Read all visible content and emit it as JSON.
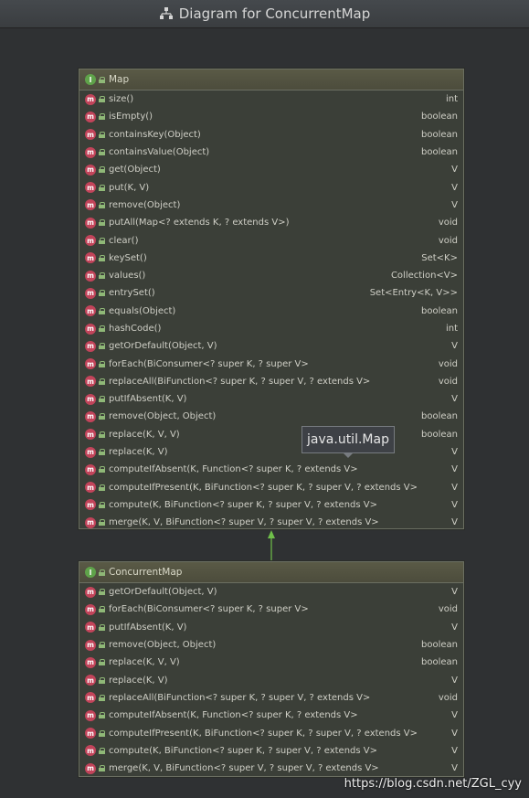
{
  "window": {
    "title": "Diagram for ConcurrentMap"
  },
  "map_panel": {
    "name": "Map",
    "methods": [
      {
        "name": "size()",
        "type": "int"
      },
      {
        "name": "isEmpty()",
        "type": "boolean"
      },
      {
        "name": "containsKey(Object)",
        "type": "boolean"
      },
      {
        "name": "containsValue(Object)",
        "type": "boolean"
      },
      {
        "name": "get(Object)",
        "type": "V"
      },
      {
        "name": "put(K, V)",
        "type": "V"
      },
      {
        "name": "remove(Object)",
        "type": "V"
      },
      {
        "name": "putAll(Map<? extends K, ? extends V>)",
        "type": "void"
      },
      {
        "name": "clear()",
        "type": "void"
      },
      {
        "name": "keySet()",
        "type": "Set<K>"
      },
      {
        "name": "values()",
        "type": "Collection<V>"
      },
      {
        "name": "entrySet()",
        "type": "Set<Entry<K, V>>"
      },
      {
        "name": "equals(Object)",
        "type": "boolean"
      },
      {
        "name": "hashCode()",
        "type": "int"
      },
      {
        "name": "getOrDefault(Object, V)",
        "type": "V"
      },
      {
        "name": "forEach(BiConsumer<? super K, ? super V>",
        "type": "void"
      },
      {
        "name": "replaceAll(BiFunction<? super K, ? super V, ? extends V>",
        "type": "void"
      },
      {
        "name": "putIfAbsent(K, V)",
        "type": "V"
      },
      {
        "name": "remove(Object, Object)",
        "type": "boolean"
      },
      {
        "name": "replace(K, V, V)",
        "type": "boolean"
      },
      {
        "name": "replace(K, V)",
        "type": "V"
      },
      {
        "name": "computeIfAbsent(K, Function<? super K, ? extends V>",
        "type": "V"
      },
      {
        "name": "computeIfPresent(K, BiFunction<? super K, ? super V, ? extends V>",
        "type": "V"
      },
      {
        "name": "compute(K, BiFunction<? super K, ? super V, ? extends V>",
        "type": "V"
      },
      {
        "name": "merge(K, V, BiFunction<? super V, ? super V, ? extends V>",
        "type": "V"
      }
    ]
  },
  "concurrent_panel": {
    "name": "ConcurrentMap",
    "methods": [
      {
        "name": "getOrDefault(Object, V)",
        "type": "V"
      },
      {
        "name": "forEach(BiConsumer<? super K, ? super V>",
        "type": "void"
      },
      {
        "name": "putIfAbsent(K, V)",
        "type": "V"
      },
      {
        "name": "remove(Object, Object)",
        "type": "boolean"
      },
      {
        "name": "replace(K, V, V)",
        "type": "boolean"
      },
      {
        "name": "replace(K, V)",
        "type": "V"
      },
      {
        "name": "replaceAll(BiFunction<? super K, ? super V, ? extends V>",
        "type": "void"
      },
      {
        "name": "computeIfAbsent(K, Function<? super K, ? extends V>",
        "type": "V"
      },
      {
        "name": "computeIfPresent(K, BiFunction<? super K, ? super V, ? extends V>",
        "type": "V"
      },
      {
        "name": "compute(K, BiFunction<? super K, ? super V, ? extends V>",
        "type": "V"
      },
      {
        "name": "merge(K, V, BiFunction<? super V, ? super V, ? extends V>",
        "type": "V"
      }
    ]
  },
  "tooltip": {
    "text": "java.util.Map"
  },
  "watermark": {
    "text": "https://blog.csdn.net/ZGL_cyy"
  },
  "colors": {
    "background": "#2f3133",
    "interface_icon": "#5fa34a",
    "method_icon": "#c2445a",
    "arrow": "#6fbf4a"
  },
  "icons": {
    "title": "diagram-icon",
    "interface": "interface-icon",
    "method": "method-icon",
    "visibility": "public-icon"
  }
}
